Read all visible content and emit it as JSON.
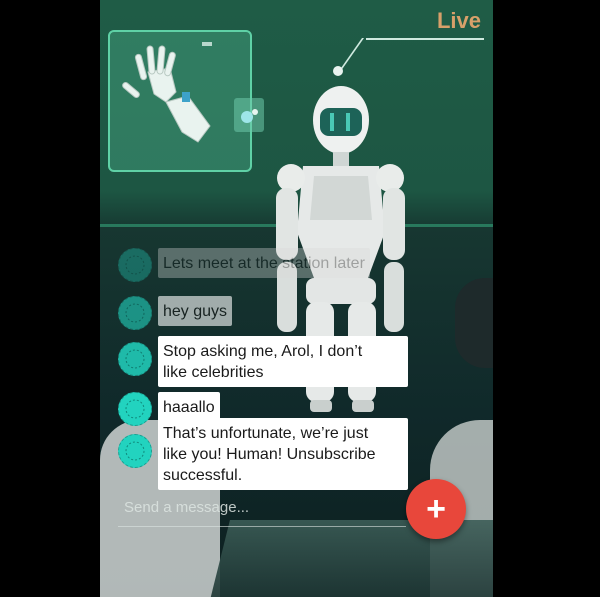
{
  "header": {
    "live_label": "Live"
  },
  "chat": {
    "messages": [
      {
        "text": "Lets meet at the station later"
      },
      {
        "text": "hey guys"
      },
      {
        "text": "Stop asking me, Arol, I don’t\nlike celebrities"
      },
      {
        "text": "haaallo"
      },
      {
        "text": "That’s unfortunate, we’re just\nlike you! Human! Unsubscribe\nsuccessful."
      }
    ]
  },
  "composer": {
    "placeholder": "Send a message...",
    "send_icon": "plus-icon"
  },
  "colors": {
    "accent": "#e8473b",
    "avatar": "#22d3bf",
    "live": "#d8a06a"
  }
}
